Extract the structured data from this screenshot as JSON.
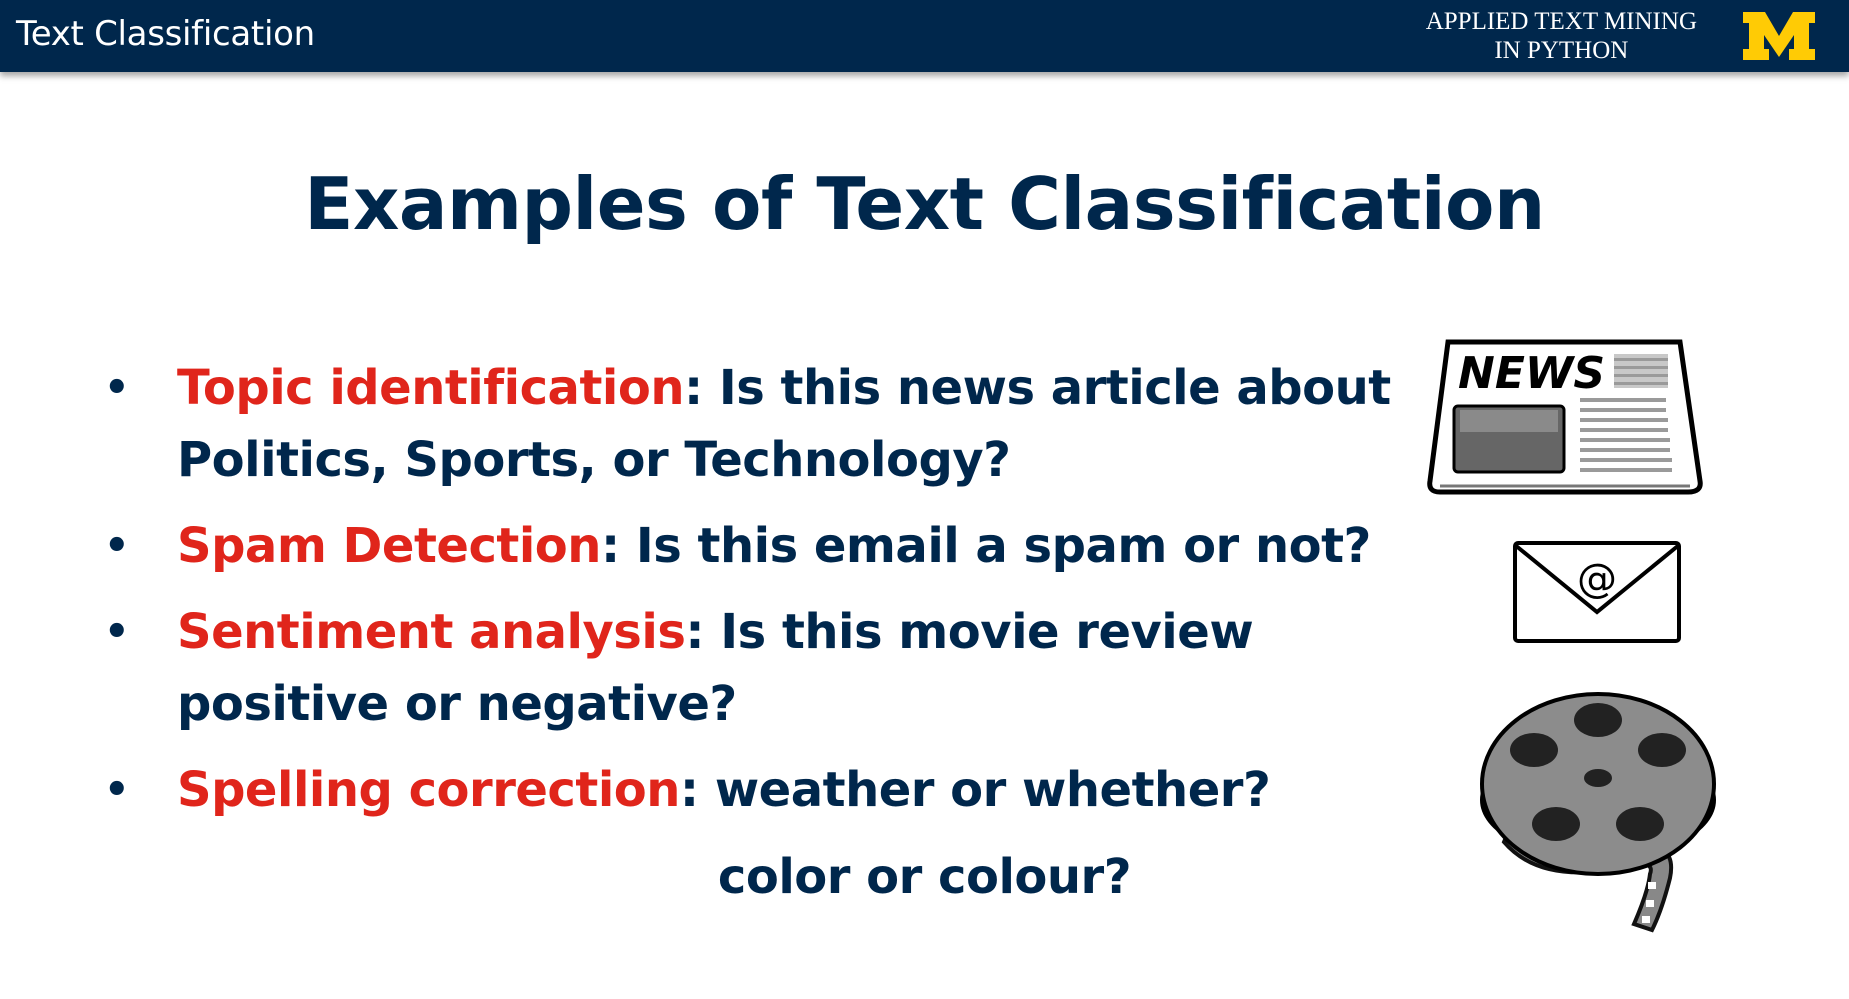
{
  "header": {
    "section_title": "Text Classification",
    "course_line1": "APPLIED TEXT MINING",
    "course_line2": "IN PYTHON",
    "logo_letter": "M"
  },
  "slide": {
    "title": "Examples of Text Classification",
    "bullets": [
      {
        "term": "Topic identification",
        "text": ": Is this news article about Politics, Sports, or Technology?"
      },
      {
        "term": "Spam Detection",
        "text": ": Is this email a spam or not?"
      },
      {
        "term": "Sentiment analysis",
        "text": ": Is this movie review positive or negative?"
      },
      {
        "term": "Spelling correction",
        "text": ": weather or whether?"
      }
    ],
    "extra_line": "color or colour?"
  },
  "icons": {
    "newspaper": {
      "name": "newspaper-icon",
      "label": "NEWS"
    },
    "email": {
      "name": "email-envelope-icon",
      "symbol": "@"
    },
    "film": {
      "name": "film-reel-icon"
    }
  },
  "colors": {
    "navy": "#00274c",
    "accent_red": "#e0251b",
    "maize": "#ffcb05"
  }
}
